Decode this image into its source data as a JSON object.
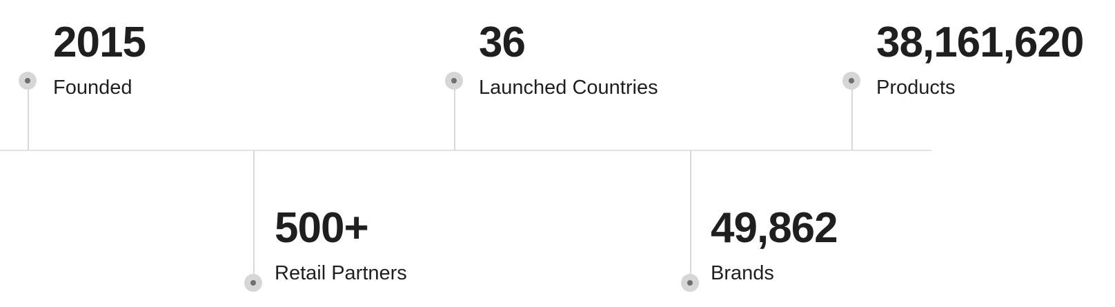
{
  "stats": {
    "founded": {
      "value": "2015",
      "label": "Founded"
    },
    "countries": {
      "value": "36",
      "label": "Launched Countries"
    },
    "products": {
      "value": "38,161,620",
      "label": "Products"
    },
    "retail_partners": {
      "value": "500+",
      "label": "Retail Partners"
    },
    "brands": {
      "value": "49,862",
      "label": "Brands"
    }
  },
  "icons": {
    "marker": "timeline-dot-icon"
  },
  "colors": {
    "text": "#1f1f1f",
    "line": "#e2e2e2",
    "dot_outer": "#d6d6d6",
    "dot_inner": "#6f6f6f"
  }
}
